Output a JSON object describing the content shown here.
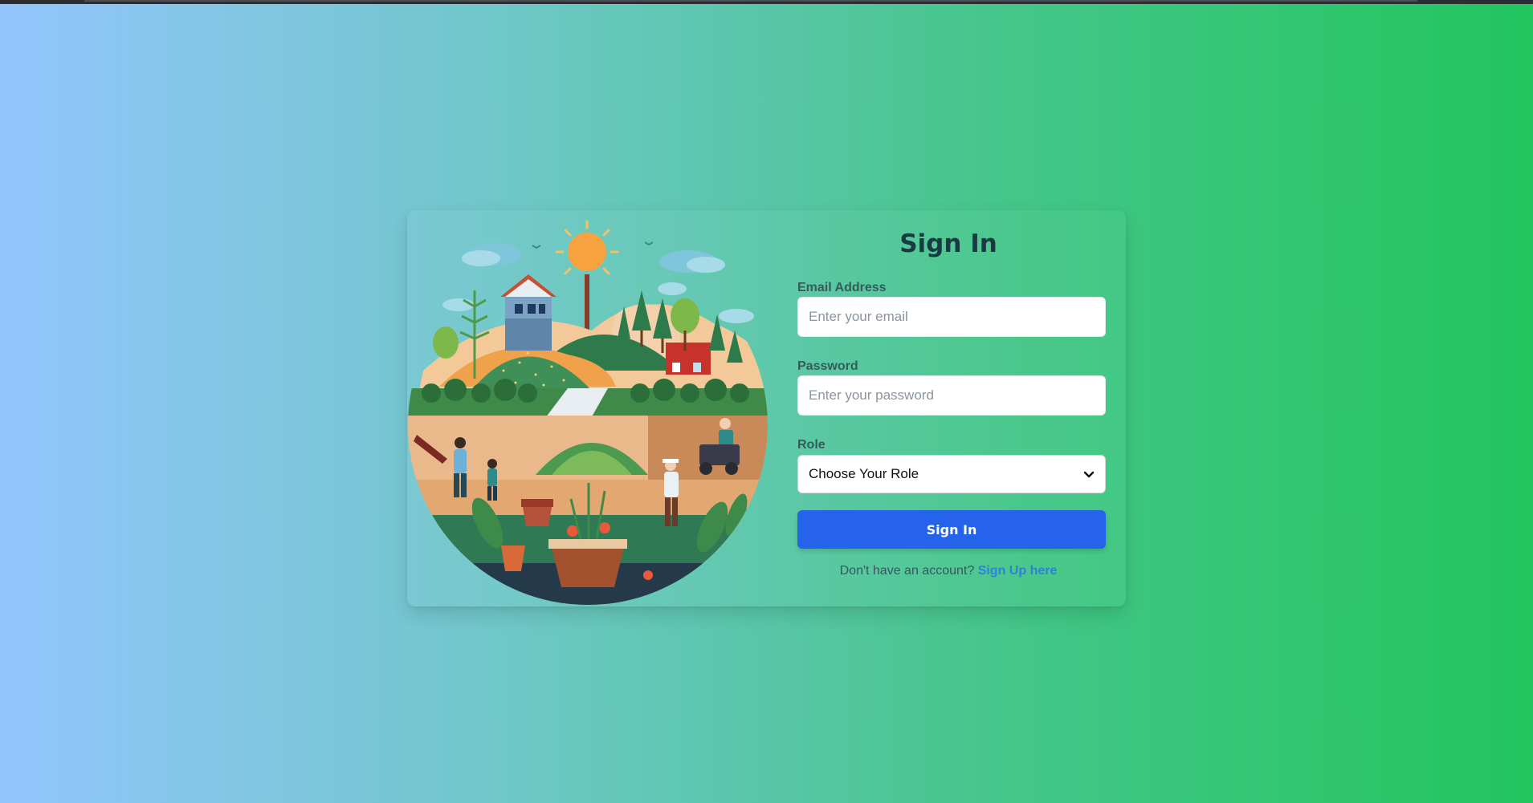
{
  "form": {
    "title": "Sign In",
    "email_label": "Email Address",
    "email_placeholder": "Enter your email",
    "password_label": "Password",
    "password_placeholder": "Enter your password",
    "role_label": "Role",
    "role_selected": "Choose Your Role",
    "submit_label": "Sign In",
    "signup_prompt": "Don't have an account?",
    "signup_link": "Sign Up here"
  },
  "colors": {
    "background_start": "#93c5fd",
    "background_end": "#22c55e",
    "button": "#2563eb",
    "link": "#2f7fe0"
  },
  "illustration": {
    "icon": "farm-landscape-illustration"
  }
}
